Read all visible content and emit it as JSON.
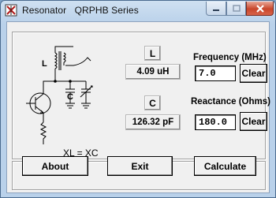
{
  "window": {
    "title": "Resonator   QRPHB Series"
  },
  "titlebar_icons": {
    "app": "resonator-app-icon",
    "minimize": "minimize-icon",
    "maximize": "maximize-icon",
    "close": "close-icon"
  },
  "schematic": {
    "inductor_label": "L",
    "capacitor_label": "C",
    "equation": "XL = XC"
  },
  "results": {
    "inductance_label": "L",
    "inductance_value": "4.09 uH",
    "capacitance_label": "C",
    "capacitance_value": "126.32 pF"
  },
  "frequency": {
    "label": "Frequency (MHz)",
    "value": "7.0",
    "clear_label": "Clear"
  },
  "reactance": {
    "label": "Reactance (Ohms)",
    "value": "180.0",
    "clear_label": "Clear"
  },
  "actions": {
    "about_label": "About",
    "exit_label": "Exit",
    "calculate_label": "Calculate"
  },
  "colors": {
    "dialog_face": "#f0f0f0",
    "titlebar": "#b9d1ea",
    "close_button": "#c8462b"
  }
}
